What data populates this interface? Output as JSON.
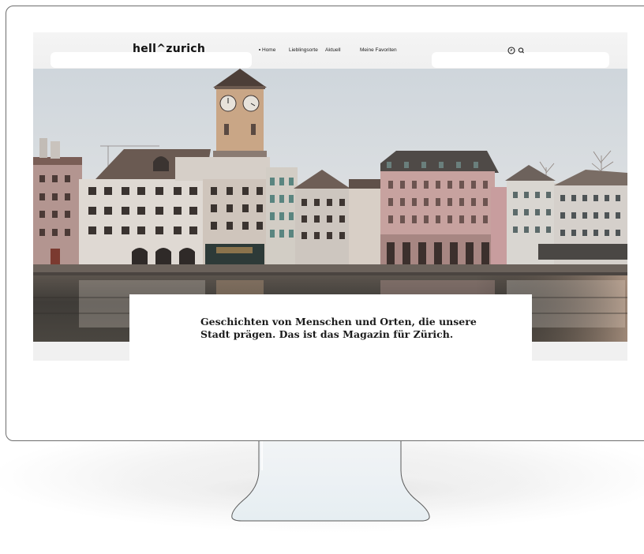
{
  "site": {
    "logo": "hell^zurich",
    "nav": {
      "home": "Home",
      "lieblingsorte": "Lieblingsorte",
      "aktuell": "Aktuell",
      "favoriten": "Meine Favoriten"
    },
    "icons": [
      "compass-icon",
      "search-icon"
    ]
  },
  "hero": {
    "tagline_line1": "Geschichten von Menschen und Orten, die unsere",
    "tagline_line2": "Stadt prägen. Das ist das Magazin für Zürich."
  },
  "colors": {
    "sky": "#d6dde2",
    "water": "#3e3b37",
    "tower": "#c7a486",
    "pink_building": "#c9a3a0",
    "text": "#1b1b1b",
    "monitor_border": "#6d6d6d"
  }
}
